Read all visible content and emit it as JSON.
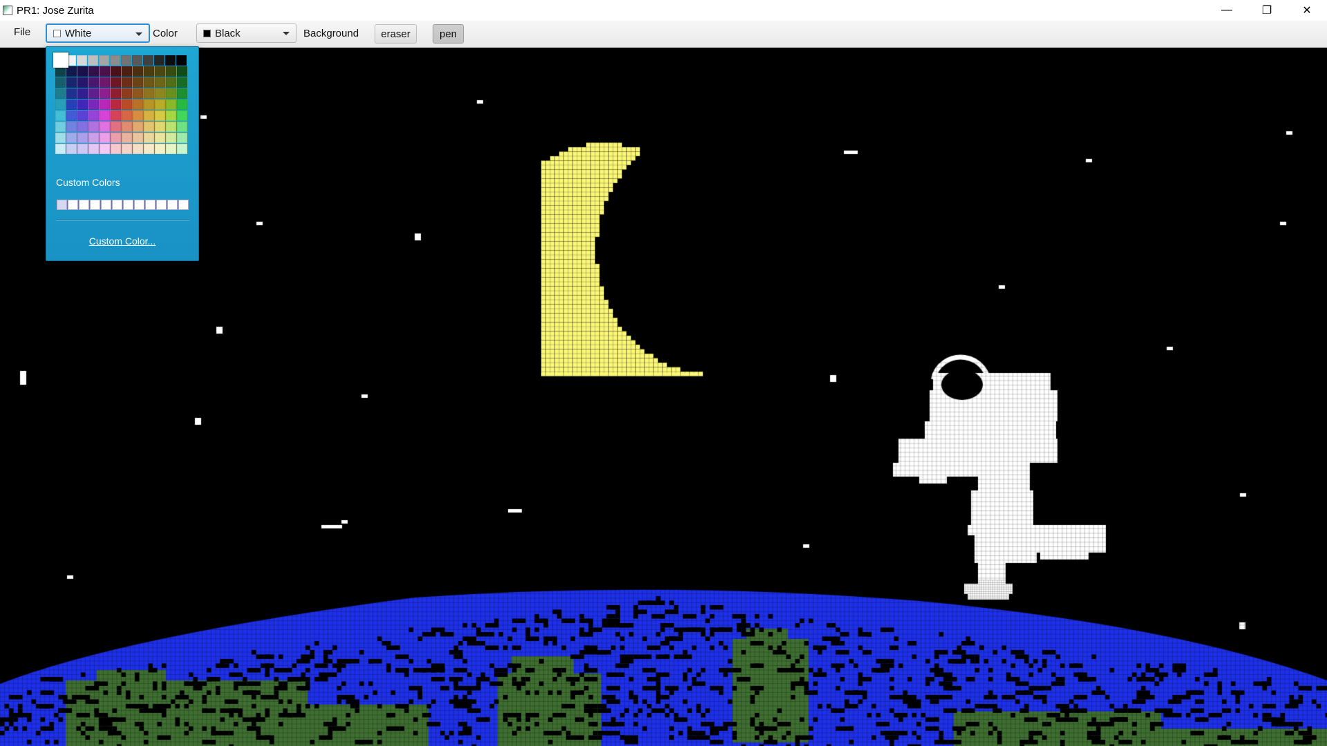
{
  "window": {
    "title": "PR1: Jose Zurita",
    "minimize_glyph": "—",
    "restore_glyph": "❐",
    "close_glyph": "✕"
  },
  "toolbar": {
    "file_label": "File",
    "color_combo": {
      "value": "White",
      "swatch": "#ffffff"
    },
    "color_label": "Color",
    "background_combo": {
      "value": "Black",
      "swatch": "#000000"
    },
    "background_label": "Background",
    "eraser_label": "eraser",
    "pen_label": "pen"
  },
  "color_popup": {
    "custom_colors_label": "Custom Colors",
    "custom_color_link": "Custom Color...",
    "selected": "#ffffff"
  },
  "colors": {
    "space": "#000000",
    "star": "#ffffff",
    "moon": "#fbf778",
    "astronaut": "#ffffff",
    "ocean": "#1e30e8",
    "land": "#3f6e32",
    "accent": "#1fa6d3"
  }
}
